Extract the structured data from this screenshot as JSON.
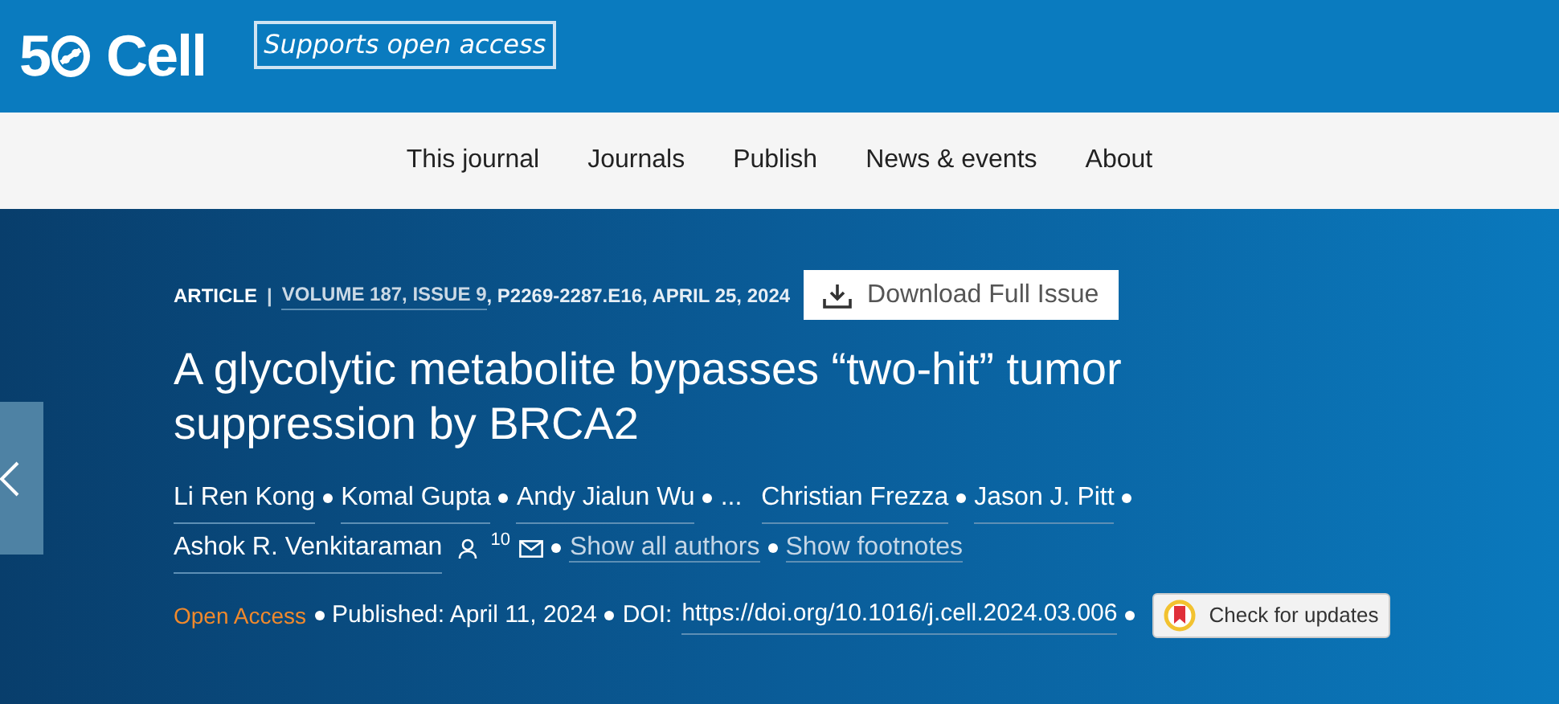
{
  "header": {
    "logo": {
      "number": "5",
      "name": "Cell"
    },
    "badge": "Supports open access"
  },
  "nav": [
    "This journal",
    "Journals",
    "Publish",
    "News & events",
    "About"
  ],
  "article": {
    "type": "ARTICLE",
    "separator": "|",
    "volume_link": "VOLUME 187, ISSUE 9",
    "citation_rest": ", P2269-2287.E16, APRIL 25, 2024",
    "download": "Download Full Issue",
    "title": "A glycolytic metabolite bypasses “two-hit” tumor suppression by BRCA2",
    "authors": [
      {
        "name": "Li Ren Kong"
      },
      {
        "name": "Komal Gupta"
      },
      {
        "name": "Andy Jialun Wu"
      },
      {
        "name": "Christian Frezza"
      },
      {
        "name": "Jason J. Pitt"
      },
      {
        "name": "Ashok R. Venkitaraman",
        "corresponding": true,
        "note": "10"
      }
    ],
    "ellipsis": "...",
    "show_all": "Show all authors",
    "show_footnotes": "Show footnotes",
    "open_access": "Open Access",
    "published": "Published: April 11, 2024",
    "doi_label": "DOI:",
    "doi": "https://doi.org/10.1016/j.cell.2024.03.006",
    "check_updates": "Check for updates"
  }
}
